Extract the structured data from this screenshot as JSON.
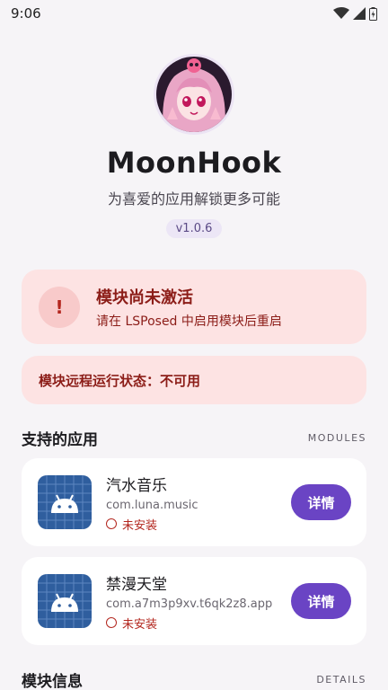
{
  "status_bar": {
    "time": "9:06"
  },
  "header": {
    "app_name": "MoonHook",
    "tagline": "为喜爱的应用解锁更多可能",
    "version": "v1.0.6"
  },
  "warning": {
    "icon": "!",
    "title": "模块尚未激活",
    "subtitle": "请在 LSPosed 中启用模块后重启"
  },
  "remote_status": {
    "text": "模块远程运行状态：不可用"
  },
  "supported_apps": {
    "title": "支持的应用",
    "tag": "MODULES",
    "items": [
      {
        "name": "汽水音乐",
        "package": "com.luna.music",
        "status": "未安装",
        "button": "详情"
      },
      {
        "name": "禁漫天堂",
        "package": "com.a7m3p9xv.t6qk2z8.app",
        "status": "未安装",
        "button": "详情"
      }
    ]
  },
  "module_info": {
    "title": "模块信息",
    "tag": "DETAILS"
  },
  "colors": {
    "accent": "#6a44c4",
    "error": "#b3261e",
    "error_container": "#fde3e3"
  }
}
